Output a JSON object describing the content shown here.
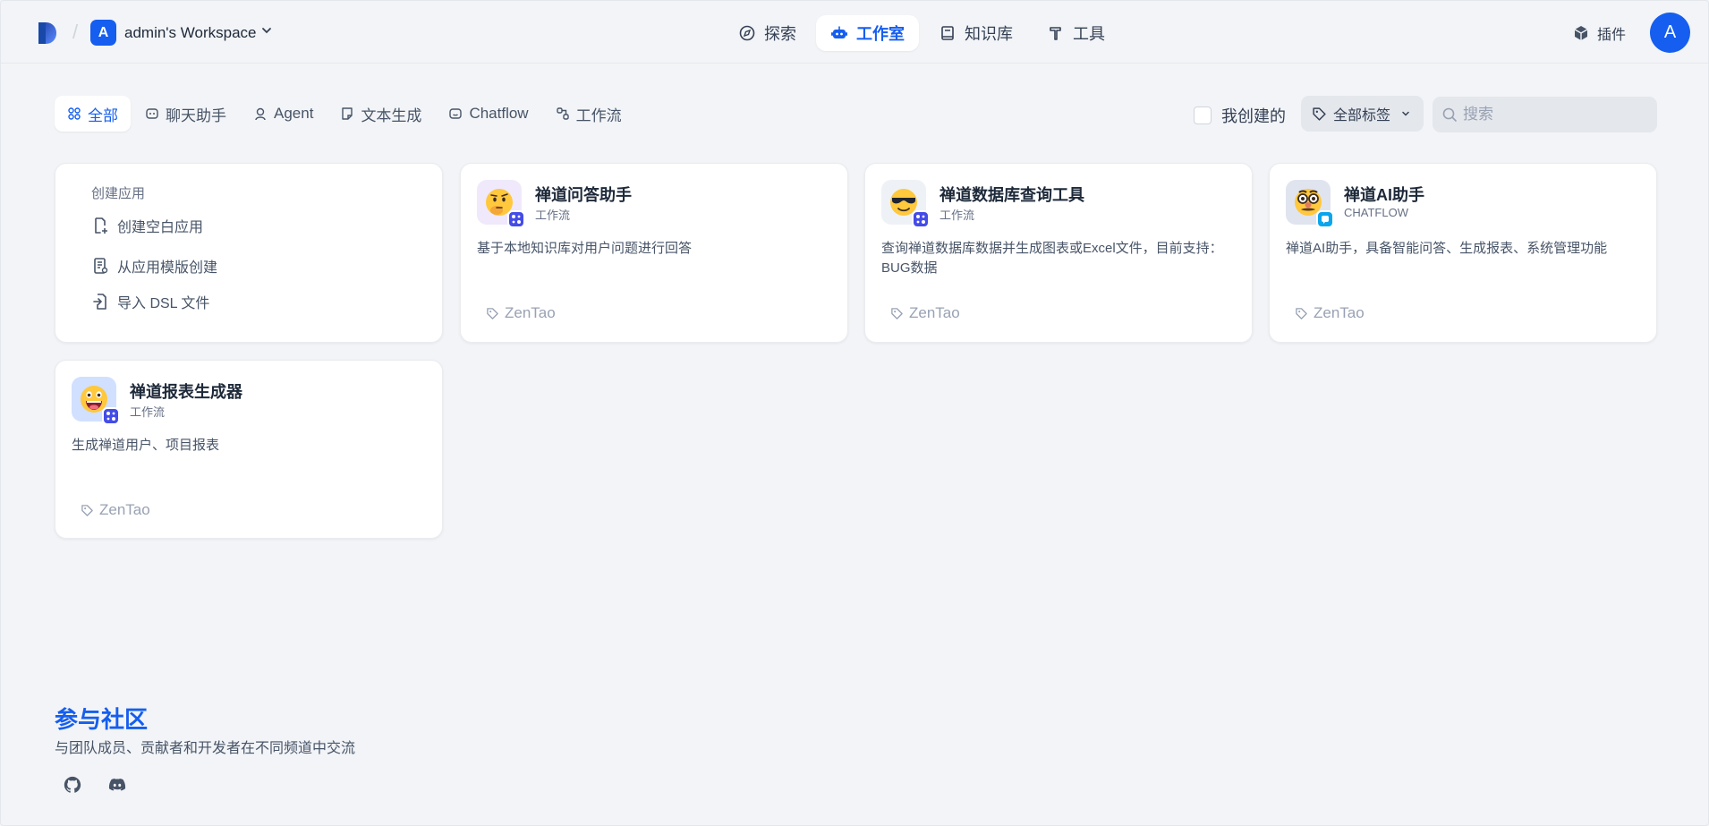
{
  "header": {
    "workspace_initial": "A",
    "workspace_name": "admin's Workspace",
    "nav": [
      {
        "label": "探索",
        "icon": "compass-icon"
      },
      {
        "label": "工作室",
        "icon": "robot-icon",
        "active": true
      },
      {
        "label": "知识库",
        "icon": "book-icon"
      },
      {
        "label": "工具",
        "icon": "hammer-icon"
      }
    ],
    "plugin_label": "插件",
    "user_initial": "A"
  },
  "filters": {
    "tabs": [
      {
        "label": "全部",
        "icon": "grid-icon",
        "active": true
      },
      {
        "label": "聊天助手",
        "icon": "chat-bot-icon"
      },
      {
        "label": "Agent",
        "icon": "agent-icon"
      },
      {
        "label": "文本生成",
        "icon": "document-icon"
      },
      {
        "label": "Chatflow",
        "icon": "chatflow-icon"
      },
      {
        "label": "工作流",
        "icon": "workflow-icon"
      }
    ],
    "created_by_me_label": "我创建的",
    "tag_filter_label": "全部标签",
    "search_placeholder": "搜索"
  },
  "create": {
    "title": "创建应用",
    "blank": "创建空白应用",
    "template": "从应用模版创建",
    "import": "导入 DSL 文件"
  },
  "apps": [
    {
      "name": "禅道问答助手",
      "type": "工作流",
      "description": "基于本地知识库对用户问题进行回答",
      "tag": "ZenTao",
      "icon": "thinking-face-icon"
    },
    {
      "name": "禅道数据库查询工具",
      "type": "工作流",
      "description": "查询禅道数据库数据并生成图表或Excel文件，目前支持：BUG数据",
      "tag": "ZenTao",
      "icon": "sunglasses-face-icon"
    },
    {
      "name": "禅道AI助手",
      "type": "CHATFLOW",
      "description": "禅道AI助手，具备智能问答、生成报表、系统管理功能",
      "tag": "ZenTao",
      "icon": "disguised-face-icon"
    },
    {
      "name": "禅道报表生成器",
      "type": "工作流",
      "description": "生成禅道用户、项目报表",
      "tag": "ZenTao",
      "icon": "grinning-face-icon"
    }
  ],
  "footer": {
    "title": "参与社区",
    "subtitle": "与团队成员、贡献者和开发者在不同频道中交流"
  },
  "colors": {
    "accent": "#155eef",
    "background": "#f2f4f7",
    "workflow_badge": "#444ce7",
    "chatflow_badge": "#0ba5ec"
  }
}
